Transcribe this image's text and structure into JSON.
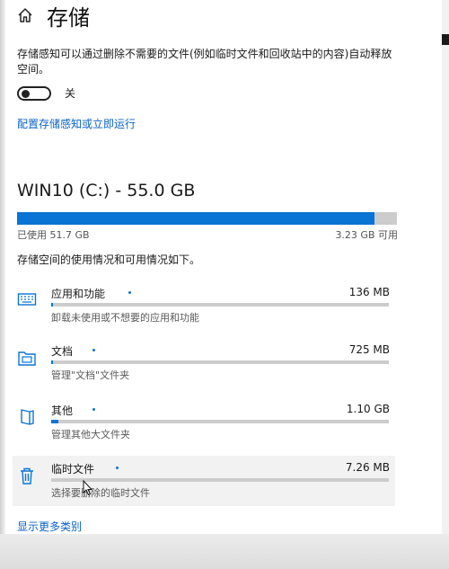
{
  "header": {
    "title": "存储",
    "icon": "home-icon"
  },
  "storage_sense": {
    "description": "存储感知可以通过删除不需要的文件(例如临时文件和回收站中的内容)自动释放空间。",
    "toggle_state_label": "关",
    "toggle_on": false,
    "config_link": "配置存储感知或立即运行"
  },
  "drive": {
    "title": "WIN10 (C:) - 55.0 GB",
    "used_label": "已使用 51.7 GB",
    "free_label": "3.23 GB 可用",
    "used_fraction": 0.94
  },
  "summary_text": "存储空间的使用情况和可用情况如下。",
  "categories": [
    {
      "name": "应用和功能",
      "size": "136 MB",
      "sub": "卸载未使用或不想要的应用和功能",
      "icon": "apps-icon",
      "fraction": 0.004
    },
    {
      "name": "文档",
      "size": "725 MB",
      "sub": "管理\"文档\"文件夹",
      "icon": "documents-icon",
      "fraction": 0.003
    },
    {
      "name": "其他",
      "size": "1.10 GB",
      "sub": "管理其他大文件夹",
      "icon": "other-icon",
      "fraction": 0.02
    },
    {
      "name": "临时文件",
      "size": "7.26 MB",
      "sub": "选择要删除的临时文件",
      "icon": "trash-icon",
      "fraction": 0.0
    }
  ],
  "more_link": "显示更多类别",
  "colors": {
    "accent": "#0a74d4",
    "link": "#0b63c7",
    "track": "#cccccc"
  }
}
